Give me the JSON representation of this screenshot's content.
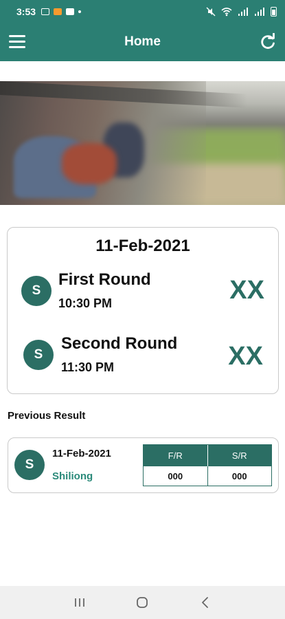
{
  "status_bar": {
    "time": "3:53",
    "right_icons": [
      "mute-icon",
      "wifi-icon",
      "signal-icon",
      "signal-icon",
      "battery-icon"
    ]
  },
  "app_bar": {
    "title": "Home",
    "menu_icon": "hamburger-menu-icon",
    "refresh_icon": "refresh-icon",
    "color": "#2b7f73"
  },
  "today": {
    "date": "11-Feb-2021",
    "rounds": [
      {
        "avatar": "S",
        "name": "First Round",
        "time": "10:30 PM",
        "result": "XX"
      },
      {
        "avatar": "S",
        "name": "Second Round",
        "time": "11:30 PM",
        "result": "XX"
      }
    ]
  },
  "previous": {
    "heading": "Previous Result",
    "items": [
      {
        "avatar": "S",
        "date": "11-Feb-2021",
        "location": "Shiliong",
        "headers": [
          "F/R",
          "S/R"
        ],
        "values": [
          "000",
          "000"
        ]
      }
    ]
  },
  "colors": {
    "accent": "#2b6e64",
    "location": "#2b8a7a"
  },
  "nav_bar": {
    "icons": [
      "recents-icon",
      "home-icon",
      "back-icon"
    ]
  }
}
